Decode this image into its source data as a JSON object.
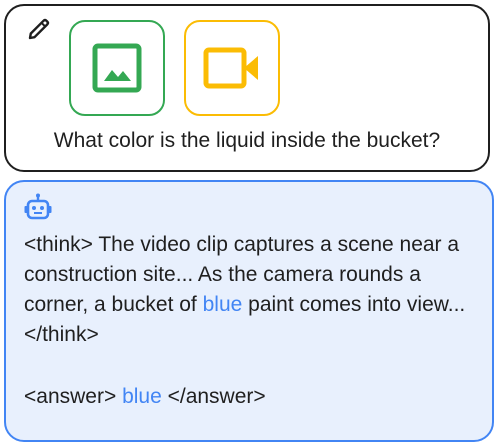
{
  "prompt": {
    "question": "What color is the liquid inside the bucket?",
    "icons": [
      "pencil-icon",
      "image-icon",
      "video-icon"
    ]
  },
  "response": {
    "think_part1": "<think> The video clip captures a scene near a construction site... As the camera rounds a corner, a bucket of ",
    "think_highlight": "blue",
    "think_part2": " paint comes into view... </think>",
    "answer_open": "<answer> ",
    "answer_value": "blue",
    "answer_close": " </answer>",
    "icon": "robot-icon"
  },
  "colors": {
    "image_tile": "#34a853",
    "video_tile": "#fbbc04",
    "response_border": "#4285f4",
    "response_bg": "#e8f0fd",
    "highlight": "#4285f4"
  }
}
